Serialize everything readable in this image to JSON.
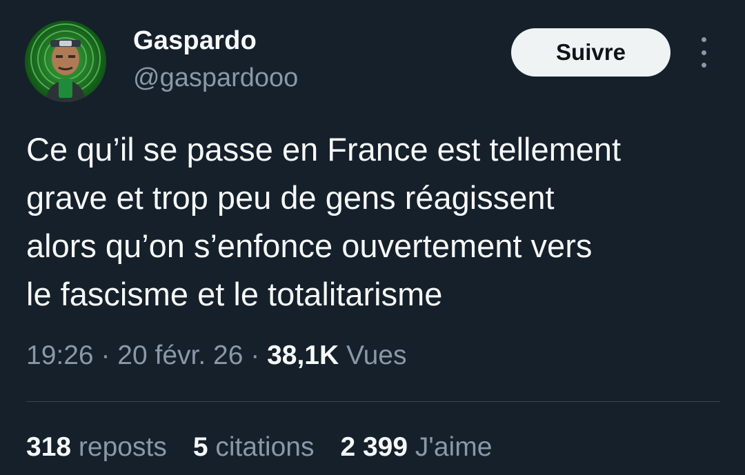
{
  "user": {
    "display_name": "Gaspardo",
    "handle": "@gaspardooo"
  },
  "follow_label": "Suivre",
  "tweet": {
    "text": "Ce qu’il se passe en France est tellement\ngrave et trop peu de gens réagissent\nalors qu’on s’enfonce ouvertement vers\nle fascisme et le totalitarisme"
  },
  "meta": {
    "time": "19:26",
    "sep1": " · ",
    "date": "20 févr. 26",
    "sep2": " · ",
    "views_count": "38,1K",
    "views_label": "Vues"
  },
  "stats": {
    "reposts_count": "318",
    "reposts_label": "reposts",
    "quotes_count": "5",
    "quotes_label": "citations",
    "likes_count": "2 399",
    "likes_label": "J'aime"
  },
  "colors": {
    "background": "#15202b",
    "primary_text": "#f7f9f9",
    "secondary_text": "#8b98a5",
    "button_bg": "#eff3f4",
    "divider": "#38444d"
  },
  "icons": {
    "more": "more-vertical-icon"
  }
}
